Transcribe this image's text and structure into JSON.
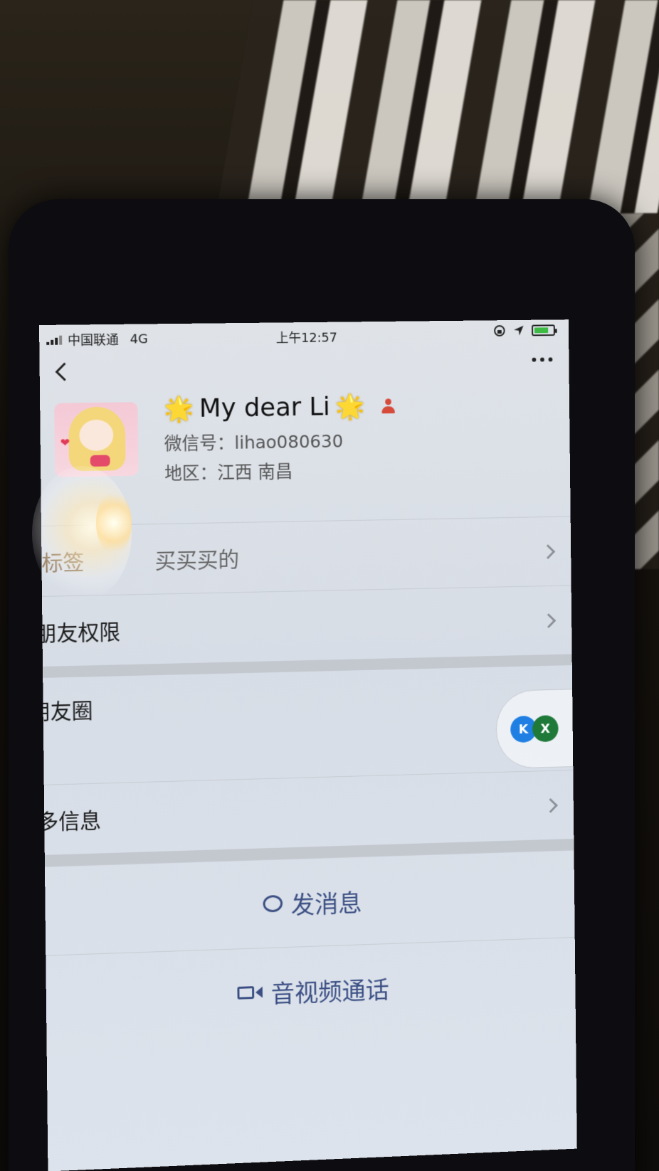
{
  "status_bar": {
    "carrier": "中国联通",
    "network": "4G",
    "time": "上午12:57",
    "battery_fill_fraction": 0.75
  },
  "nav": {
    "back_icon": "chevron-left-icon",
    "more_icon": "ellipsis-icon"
  },
  "profile": {
    "name": "My dear Li",
    "name_decoration": "🌟",
    "wechat_id_label": "微信号：",
    "wechat_id": "lihao080630",
    "region_label": "地区：",
    "region": "江西 南昌"
  },
  "rows": {
    "tags_label": "标签",
    "tags_value": "买买买的",
    "permissions_label": "朋友权限",
    "moments_label": "朋友圈",
    "more_info_label": "更多信息"
  },
  "actions": {
    "send_message": "发消息",
    "av_call": "音视频通话"
  },
  "floating": {
    "left_button_text": "K",
    "right_button_text": "X",
    "left_color": "#1f7fe3",
    "right_color": "#1f7a3a"
  }
}
